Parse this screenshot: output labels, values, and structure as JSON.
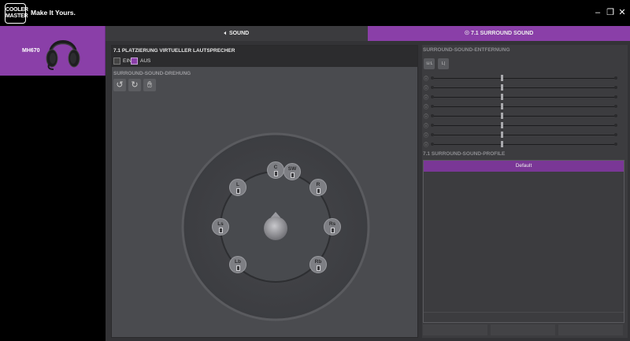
{
  "app": {
    "logo_line1": "COOLER",
    "logo_line2": "MASTER",
    "tagline": "Make It Yours.",
    "window_controls": [
      "minimize-icon",
      "restore-icon",
      "close-icon"
    ]
  },
  "device": {
    "name": "MH670"
  },
  "tabs": [
    {
      "label": "SOUND",
      "icon": "speaker-icon",
      "active": false
    },
    {
      "label": "7.1 SURROUND SOUND",
      "icon": "surround-icon",
      "active": true
    }
  ],
  "placement": {
    "title": "7.1 PLATZIERUNG VIRTUELLER LAUTSPRECHER",
    "on_label": "EIN",
    "off_label": "AUS",
    "selected": "AUS",
    "rotation_label": "SURROUND-SOUND-DREHUNG",
    "tools": [
      "rotate-left-icon",
      "rotate-right-icon",
      "hand-icon"
    ],
    "speakers": [
      {
        "id": "C",
        "label": "C"
      },
      {
        "id": "SW",
        "label": "SW"
      },
      {
        "id": "L",
        "label": "L"
      },
      {
        "id": "R",
        "label": "R"
      },
      {
        "id": "Ls",
        "label": "Ls"
      },
      {
        "id": "Rs",
        "label": "Rs"
      },
      {
        "id": "Lb",
        "label": "Lb"
      },
      {
        "id": "Rb",
        "label": "Rb"
      }
    ]
  },
  "distance": {
    "title": "SURROUND-SOUND-ENTFERNUNG",
    "buttons": [
      "reset-distance-icon",
      "equalize-distance-icon"
    ],
    "slider_count": 8,
    "slider_levels": [
      0.37,
      0.37,
      0.37,
      0.37,
      0.37,
      0.37,
      0.37,
      0.37
    ]
  },
  "profiles": {
    "title": "7.1 SURROUND-SOUND-PROFILE",
    "items": [
      "Default"
    ],
    "selected": "Default"
  },
  "colors": {
    "accent": "#8a3fa8",
    "background": "#333336",
    "panel": "#4a4b4f"
  }
}
